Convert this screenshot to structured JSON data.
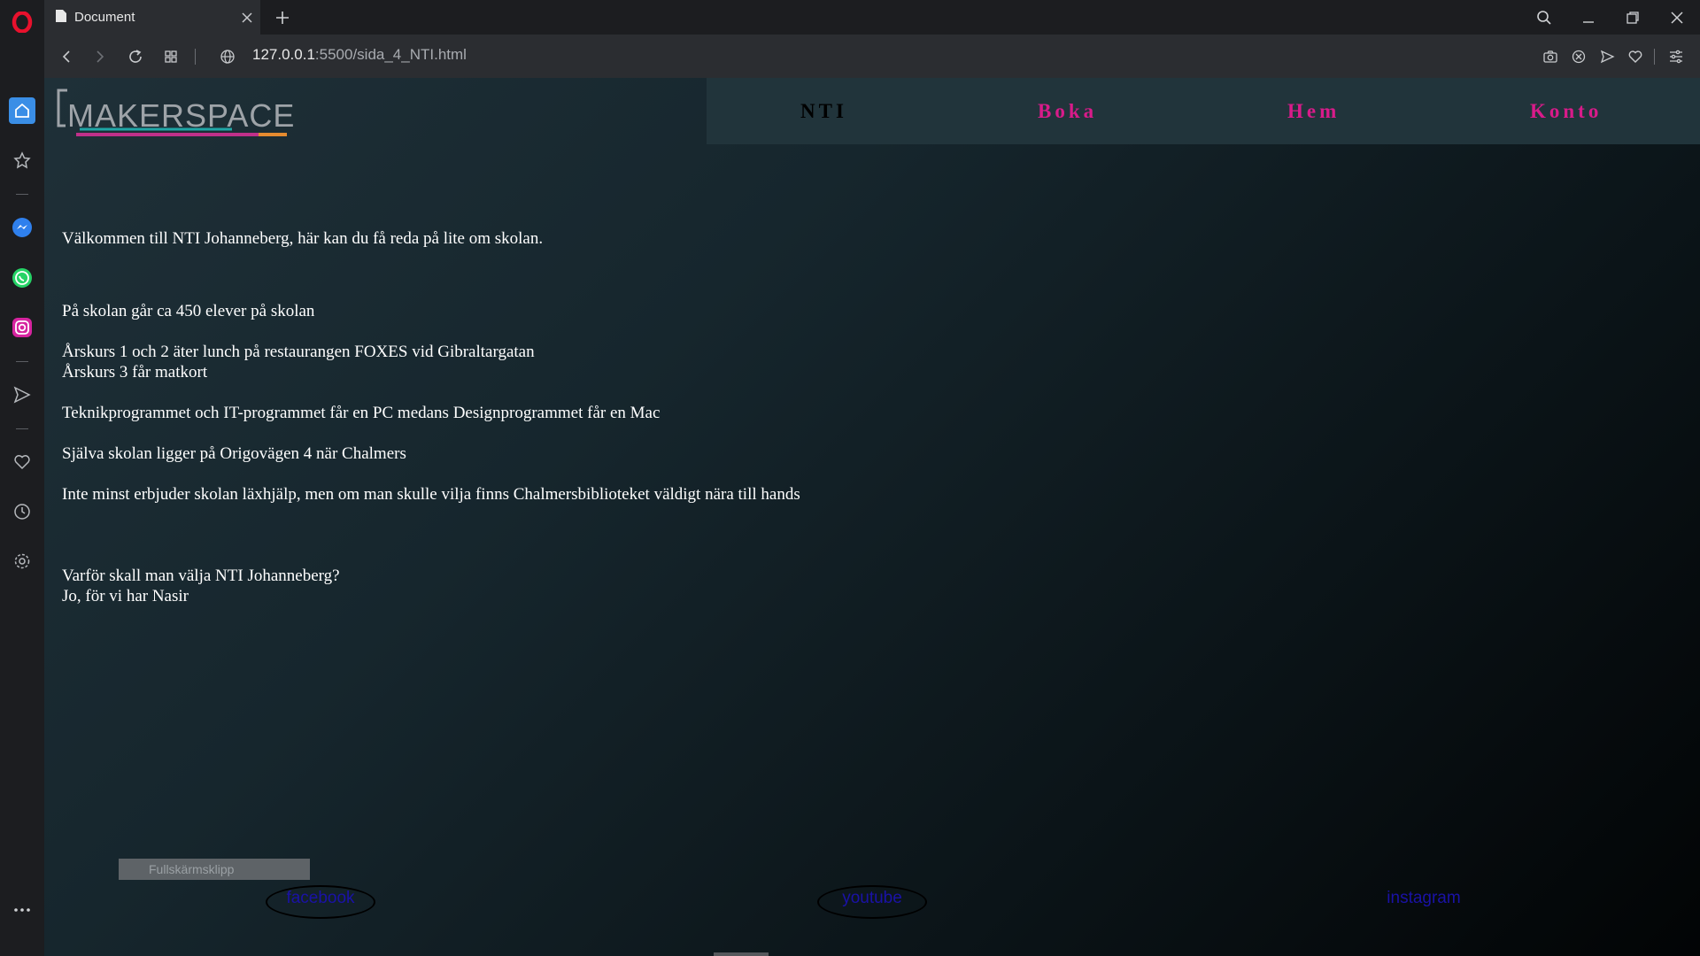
{
  "browser": {
    "tab_title": "Document",
    "url_host": "127.0.0.1",
    "url_path": ":5500/sida_4_NTI.html"
  },
  "sidebar": {
    "icons": [
      "opera-logo-icon",
      "home-icon",
      "bookmarks-icon",
      "messenger-icon",
      "whatsapp-icon",
      "instagram-icon",
      "send-icon",
      "heart-icon",
      "history-icon",
      "settings-icon",
      "more-icon"
    ]
  },
  "colors": {
    "nav_link": "#d81b8a",
    "nav_bg": "#21343b",
    "opera_red": "#e8112d"
  },
  "page": {
    "logo_text": "MAKERSPACE",
    "nav": {
      "nti": "NTI",
      "boka": "Boka",
      "hem": "Hem",
      "konto": "Konto"
    },
    "content": {
      "line1": "Välkommen till NTI Johanneberg, här kan du få reda på lite om skolan.",
      "line2": "På skolan går ca 450 elever på skolan",
      "line3": "Årskurs 1 och 2 äter lunch på restaurangen FOXES vid Gibraltargatan",
      "line4": "Årskurs 3 får matkort",
      "line5": "Teknikprogrammet och IT-programmet får en PC medans Designprogrammet får en Mac",
      "line6": "Själva skolan ligger på Origovägen 4 när Chalmers",
      "line7": "Inte minst erbjuder skolan läxhjälp, men om man skulle vilja finns Chalmersbiblioteket väldigt nära till hands",
      "line8": "Varför skall man välja NTI Johanneberg?",
      "line9": "Jo, för vi har Nasir"
    },
    "footer": {
      "facebook": "facebook",
      "youtube": "youtube",
      "instagram": "instagram"
    },
    "tooltip": "Fullskärmsklipp"
  }
}
